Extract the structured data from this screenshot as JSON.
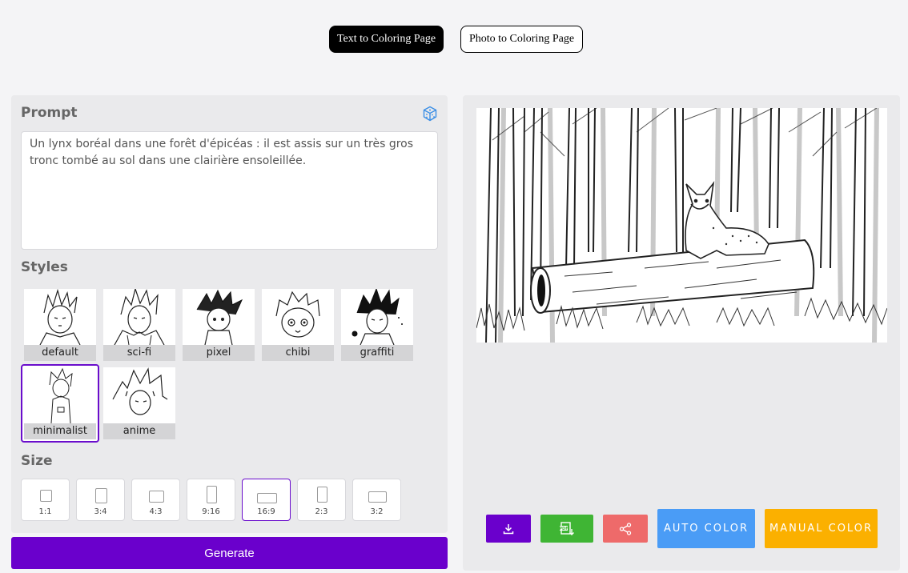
{
  "mode_tabs": {
    "text_to_coloring": "Text to Coloring Page",
    "photo_to_coloring": "Photo to Coloring Page"
  },
  "prompt": {
    "title": "Prompt",
    "value": "Un lynx boréal dans une forêt d'épicéas : il est assis sur un très gros tronc tombé au sol dans une clairière ensoleillée.",
    "random_icon": "dice-icon"
  },
  "styles": {
    "title": "Styles",
    "selected": "minimalist",
    "items": [
      {
        "label": "default"
      },
      {
        "label": "sci-fi"
      },
      {
        "label": "pixel"
      },
      {
        "label": "chibi"
      },
      {
        "label": "graffiti"
      },
      {
        "label": "minimalist"
      },
      {
        "label": "anime"
      }
    ]
  },
  "size": {
    "title": "Size",
    "selected": "16:9",
    "items": [
      {
        "label": "1:1"
      },
      {
        "label": "3:4"
      },
      {
        "label": "4:3"
      },
      {
        "label": "9:16"
      },
      {
        "label": "16:9"
      },
      {
        "label": "2:3"
      },
      {
        "label": "3:2"
      }
    ]
  },
  "generate_label": "Generate",
  "actions": {
    "download_icon": "download-icon",
    "pdf_icon": "pdf-download-icon",
    "share_icon": "share-icon",
    "auto_color_label": "AUTO COLOR",
    "manual_color_label": "MANUAL COLOR"
  },
  "colors": {
    "primary": "#6a00cc",
    "pdf_green": "#3fb534",
    "share_red": "#ee6a6a",
    "auto_blue": "#4a9cf6",
    "manual_orange": "#fbb000"
  }
}
